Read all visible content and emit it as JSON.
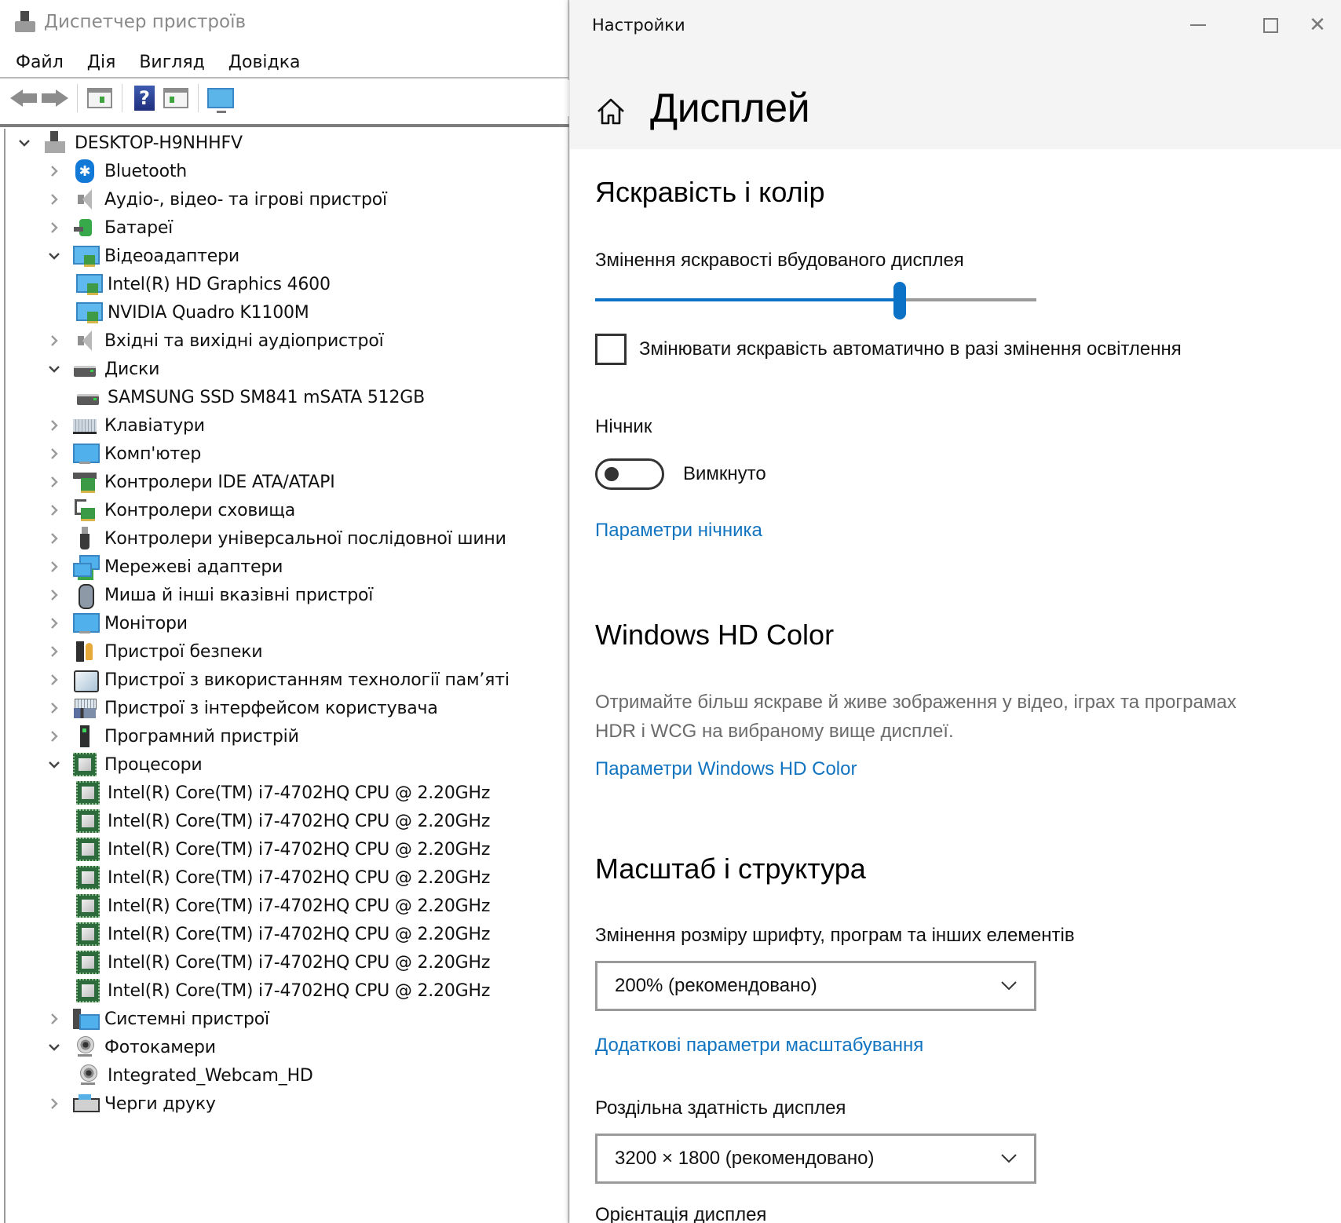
{
  "device_manager": {
    "title": "Диспетчер пристроїв",
    "menu": [
      "Файл",
      "Дія",
      "Вигляд",
      "Довідка"
    ],
    "toolbar": [
      "back-icon",
      "forward-icon",
      "show-hide-console-tree-icon",
      "help-icon",
      "action-pane-icon",
      "scan-hardware-monitor-icon"
    ],
    "tree": [
      {
        "label": "DESKTOP-H9NHHFV",
        "level": 0,
        "state": "expanded",
        "icon": "computer"
      },
      {
        "label": "Bluetooth",
        "level": 1,
        "state": "collapsed",
        "icon": "bluetooth"
      },
      {
        "label": "Аудіо-, відео- та ігрові пристрої",
        "level": 1,
        "state": "collapsed",
        "icon": "speaker"
      },
      {
        "label": "Батареї",
        "level": 1,
        "state": "collapsed",
        "icon": "battery"
      },
      {
        "label": "Відеоадаптери",
        "level": 1,
        "state": "expanded",
        "icon": "display"
      },
      {
        "label": "Intel(R) HD Graphics 4600",
        "level": 2,
        "state": "leaf",
        "icon": "display"
      },
      {
        "label": "NVIDIA Quadro K1100M",
        "level": 2,
        "state": "leaf",
        "icon": "display"
      },
      {
        "label": "Вхідні та вихідні аудіопристрої",
        "level": 1,
        "state": "collapsed",
        "icon": "speaker"
      },
      {
        "label": "Диски",
        "level": 1,
        "state": "expanded",
        "icon": "drive"
      },
      {
        "label": "SAMSUNG SSD SM841 mSATA 512GB",
        "level": 2,
        "state": "leaf",
        "icon": "drive"
      },
      {
        "label": "Клавіатури",
        "level": 1,
        "state": "collapsed",
        "icon": "keyboard"
      },
      {
        "label": "Комп'ютер",
        "level": 1,
        "state": "collapsed",
        "icon": "monitor"
      },
      {
        "label": "Контролери IDE ATA/ATAPI",
        "level": 1,
        "state": "collapsed",
        "icon": "ide"
      },
      {
        "label": "Контролери сховища",
        "level": 1,
        "state": "collapsed",
        "icon": "storage"
      },
      {
        "label": "Контролери універсальної послідовної шини",
        "level": 1,
        "state": "collapsed",
        "icon": "usb"
      },
      {
        "label": "Мережеві адаптери",
        "level": 1,
        "state": "collapsed",
        "icon": "network"
      },
      {
        "label": "Миша й інші вказівні пристрої",
        "level": 1,
        "state": "collapsed",
        "icon": "mouse"
      },
      {
        "label": "Монітори",
        "level": 1,
        "state": "collapsed",
        "icon": "monitor"
      },
      {
        "label": "Пристрої безпеки",
        "level": 1,
        "state": "collapsed",
        "icon": "security"
      },
      {
        "label": "Пристрої з використанням технології пам’яті",
        "level": 1,
        "state": "collapsed",
        "icon": "memory"
      },
      {
        "label": "Пристрої з інтерфейсом користувача",
        "level": 1,
        "state": "collapsed",
        "icon": "hid"
      },
      {
        "label": "Програмний пристрій",
        "level": 1,
        "state": "collapsed",
        "icon": "software"
      },
      {
        "label": "Процесори",
        "level": 1,
        "state": "expanded",
        "icon": "cpu"
      },
      {
        "label": "Intel(R) Core(TM) i7-4702HQ CPU @ 2.20GHz",
        "level": 2,
        "state": "leaf",
        "icon": "cpu"
      },
      {
        "label": "Intel(R) Core(TM) i7-4702HQ CPU @ 2.20GHz",
        "level": 2,
        "state": "leaf",
        "icon": "cpu"
      },
      {
        "label": "Intel(R) Core(TM) i7-4702HQ CPU @ 2.20GHz",
        "level": 2,
        "state": "leaf",
        "icon": "cpu"
      },
      {
        "label": "Intel(R) Core(TM) i7-4702HQ CPU @ 2.20GHz",
        "level": 2,
        "state": "leaf",
        "icon": "cpu"
      },
      {
        "label": "Intel(R) Core(TM) i7-4702HQ CPU @ 2.20GHz",
        "level": 2,
        "state": "leaf",
        "icon": "cpu"
      },
      {
        "label": "Intel(R) Core(TM) i7-4702HQ CPU @ 2.20GHz",
        "level": 2,
        "state": "leaf",
        "icon": "cpu"
      },
      {
        "label": "Intel(R) Core(TM) i7-4702HQ CPU @ 2.20GHz",
        "level": 2,
        "state": "leaf",
        "icon": "cpu"
      },
      {
        "label": "Intel(R) Core(TM) i7-4702HQ CPU @ 2.20GHz",
        "level": 2,
        "state": "leaf",
        "icon": "cpu"
      },
      {
        "label": "Системні пристрої",
        "level": 1,
        "state": "collapsed",
        "icon": "system"
      },
      {
        "label": "Фотокамери",
        "level": 1,
        "state": "expanded",
        "icon": "camera"
      },
      {
        "label": "Integrated_Webcam_HD",
        "level": 2,
        "state": "leaf",
        "icon": "camera"
      },
      {
        "label": "Черги друку",
        "level": 1,
        "state": "collapsed",
        "icon": "printer"
      }
    ]
  },
  "settings": {
    "app_title": "Настройки",
    "window_controls": {
      "minimize": "minimize-icon",
      "maximize": "maximize-icon",
      "close": "close-icon",
      "close_glyph": "✕"
    },
    "page_title": "Дисплей",
    "brightness_section": {
      "heading": "Яскравість і колір",
      "slider_label": "Змінення яскравості вбудованого дисплея",
      "brightness_percent": 69,
      "auto_brightness_label": "Змінювати яскравість автоматично в разі змінення освітлення",
      "auto_brightness_checked": false,
      "night_light_label": "Нічник",
      "night_light_state": "Вимкнуто",
      "night_light_on": false,
      "night_light_link": "Параметри нічника"
    },
    "hd_color_section": {
      "heading": "Windows HD Color",
      "description": "Отримайте більш яскраве й живе зображення у відео, іграх та програмах HDR і WCG на вибраному вище дисплеї.",
      "link": "Параметри Windows HD Color"
    },
    "scale_section": {
      "heading": "Масштаб і структура",
      "scale_label": "Змінення розміру шрифту, програм та інших елементів",
      "scale_value": "200% (рекомендовано)",
      "advanced_link": "Додаткові параметри масштабування",
      "resolution_label": "Роздільна здатність дисплея",
      "resolution_value": "3200 × 1800 (рекомендовано)",
      "orientation_label": "Орієнтація дисплея"
    },
    "colors": {
      "accent": "#0b72c6",
      "link": "#1174c0",
      "header_bg": "#f4f4f4"
    }
  }
}
